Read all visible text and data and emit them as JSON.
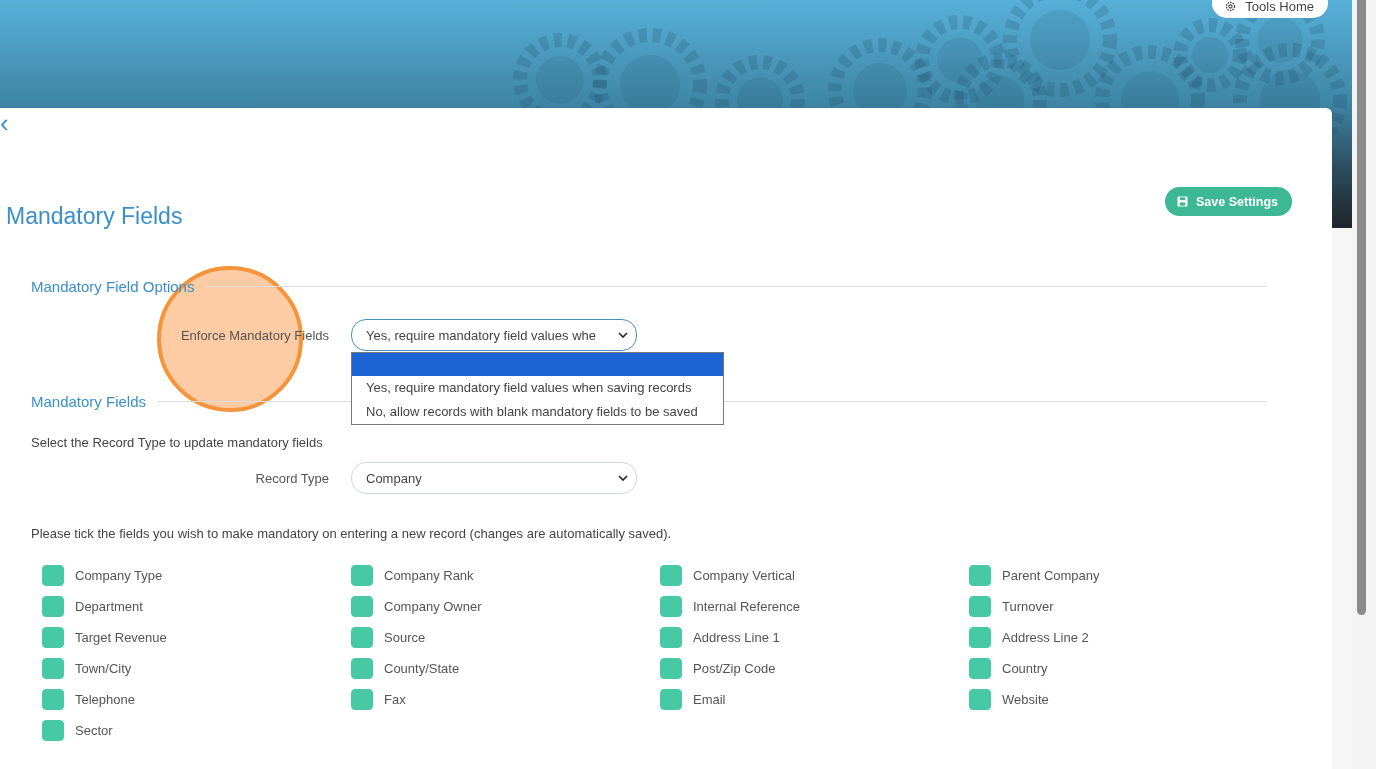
{
  "header": {
    "tools_home_button": "Tools Home"
  },
  "page": {
    "back_icon": "‹",
    "title": "Mandatory Fields",
    "save_button": "Save Settings"
  },
  "options_section": {
    "heading": "Mandatory Field Options",
    "enforce_label": "Enforce Mandatory Fields",
    "enforce_value": "Yes, require mandatory field values whe",
    "dropdown": {
      "open": true,
      "blank_option_highlighted": true,
      "options": [
        {
          "label": "Yes, require mandatory field values when saving records",
          "selected": false
        },
        {
          "label": "No, allow records with blank mandatory fields to be saved",
          "selected": false
        }
      ]
    }
  },
  "click_highlight": {
    "shown": true
  },
  "fields_section": {
    "heading": "Mandatory Fields",
    "intro": "Select the Record Type to update mandatory fields",
    "record_type_label": "Record Type",
    "record_type_value": "Company",
    "instructions": "Please tick the fields you wish to make mandatory on entering a new record (changes are automatically saved).",
    "fields": [
      {
        "label": "Company Type",
        "checked": true
      },
      {
        "label": "Company Rank",
        "checked": true
      },
      {
        "label": "Company Vertical",
        "checked": true
      },
      {
        "label": "Parent Company",
        "checked": true
      },
      {
        "label": "Department",
        "checked": true
      },
      {
        "label": "Company Owner",
        "checked": true
      },
      {
        "label": "Internal Reference",
        "checked": true
      },
      {
        "label": "Turnover",
        "checked": true
      },
      {
        "label": "Target Revenue",
        "checked": true
      },
      {
        "label": "Source",
        "checked": true
      },
      {
        "label": "Address Line 1",
        "checked": true
      },
      {
        "label": "Address Line 2",
        "checked": true
      },
      {
        "label": "Town/City",
        "checked": true
      },
      {
        "label": "County/State",
        "checked": true
      },
      {
        "label": "Post/Zip Code",
        "checked": true
      },
      {
        "label": "Country",
        "checked": true
      },
      {
        "label": "Telephone",
        "checked": true
      },
      {
        "label": "Fax",
        "checked": true
      },
      {
        "label": "Email",
        "checked": true
      },
      {
        "label": "Website",
        "checked": true
      },
      {
        "label": "Sector",
        "checked": true
      }
    ]
  }
}
